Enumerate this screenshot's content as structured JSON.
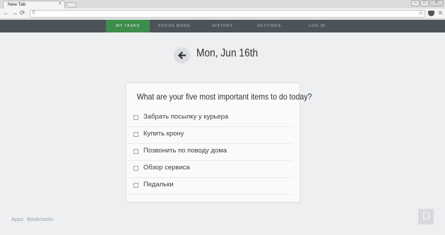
{
  "browser": {
    "tab_title": "New Tab",
    "tab_close": "×",
    "window_controls": [
      "–",
      "□",
      "×"
    ],
    "nav_icons": [
      "back-arrow",
      "forward-arrow",
      "reload"
    ],
    "omnibox_value": "",
    "toolbar_icons": [
      "star-icon",
      "pocket-icon",
      "menu-icon"
    ]
  },
  "app_nav": {
    "items": [
      {
        "label": "MY TASKS",
        "active": true
      },
      {
        "label": "FOCUS MODE",
        "active": false
      },
      {
        "label": "HISTORY",
        "active": false
      },
      {
        "label": "SETTINGS",
        "active": false
      },
      {
        "label": "LOG IN",
        "active": false
      }
    ]
  },
  "header": {
    "date": "Mon, Jun 16th",
    "back_icon": "arrow-left-icon"
  },
  "card": {
    "question": "What are your five most important items to do today?",
    "tasks": [
      {
        "label": "Забрать посылку у курьера",
        "checked": false
      },
      {
        "label": "Купить крону",
        "checked": false
      },
      {
        "label": "Позвонить по поводу дома",
        "checked": false
      },
      {
        "label": "Обзор сервиса",
        "checked": false
      },
      {
        "label": "Педальки",
        "checked": false
      }
    ]
  },
  "footer": {
    "links": [
      "Apps",
      "Bookmarks"
    ],
    "logo_letter": "D"
  },
  "colors": {
    "nav_bg": "#4c5459",
    "nav_active": "#3d8c4c",
    "page_bg": "#eeeff1"
  }
}
